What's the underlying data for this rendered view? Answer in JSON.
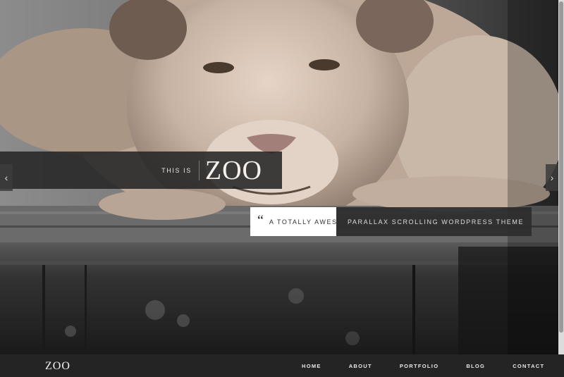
{
  "hero": {
    "image_description_icon": "lion-photo",
    "title_pre": "THIS IS",
    "title_main": "ZOO",
    "tagline_highlight": "A TOTALLY AWESOME",
    "tagline_rest": "PARALLAX SCROLLING WORDPRESS THEME",
    "prev_icon": "chevron-left-icon",
    "next_icon": "chevron-right-icon"
  },
  "nav": {
    "logo": "ZOO",
    "items": [
      {
        "label": "HOME"
      },
      {
        "label": "ABOUT"
      },
      {
        "label": "PORTFOLIO"
      },
      {
        "label": "BLOG"
      },
      {
        "label": "CONTACT"
      }
    ]
  },
  "colors": {
    "band_dark": "#262626",
    "navbar": "#242424",
    "highlight": "#ffffff"
  }
}
